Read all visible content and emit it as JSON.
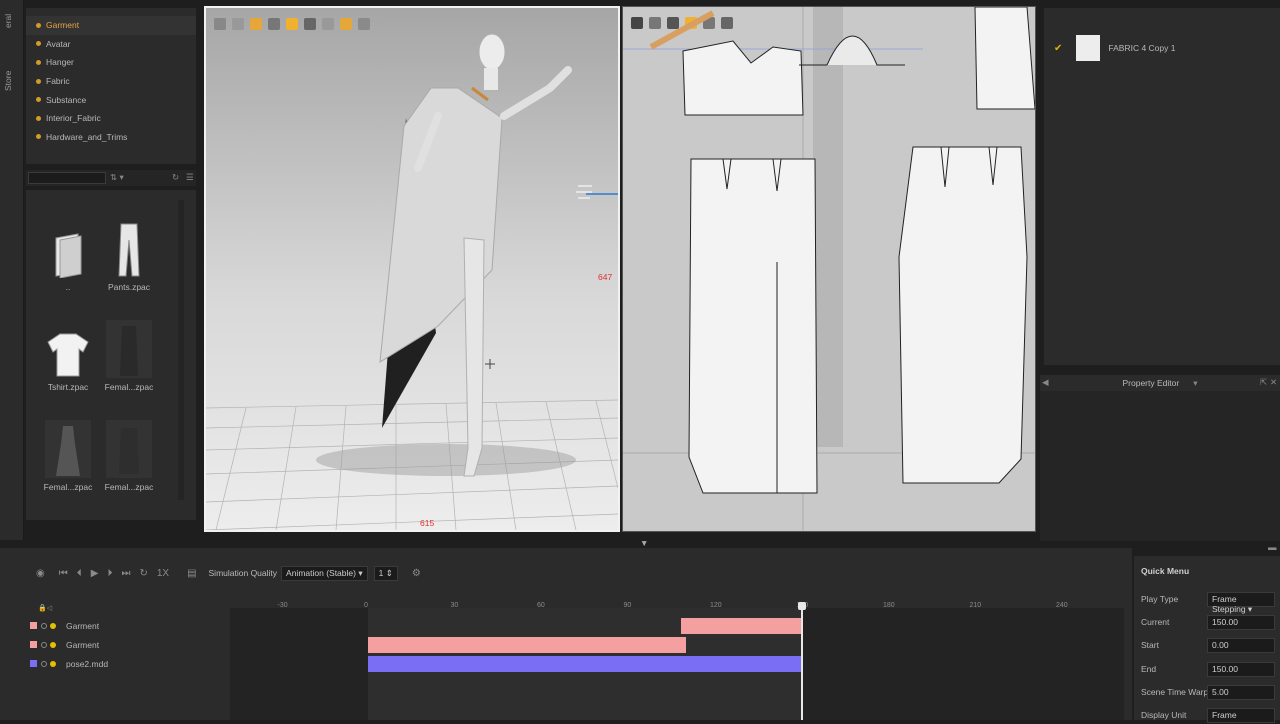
{
  "left_rail": {
    "tabs": [
      "eral",
      "Store"
    ]
  },
  "library": {
    "items": [
      {
        "label": "Garment",
        "active": true
      },
      {
        "label": "Avatar"
      },
      {
        "label": "Hanger"
      },
      {
        "label": "Fabric"
      },
      {
        "label": "Substance"
      },
      {
        "label": "Interior_Fabric"
      },
      {
        "label": "Hardware_and_Trims"
      }
    ]
  },
  "files": [
    {
      "label": "..",
      "icon": "folder-icon"
    },
    {
      "label": "Pants.zpac",
      "icon": "pants-icon"
    },
    {
      "label": "Tshirt.zpac",
      "icon": "tshirt-icon"
    },
    {
      "label": "Femal...zpac",
      "icon": "female-garment-icon"
    },
    {
      "label": "Femal...zpac",
      "icon": "dress-icon"
    },
    {
      "label": "Femal...zpac",
      "icon": "female-garment-icon"
    }
  ],
  "viewport3d": {
    "label_right": "647",
    "label_bottom": "615"
  },
  "fabric_list": {
    "items": [
      {
        "label": "FABRIC 4 Copy 1",
        "checked": true
      }
    ]
  },
  "property_editor": {
    "title": "Property Editor"
  },
  "timeline": {
    "speed": "1X",
    "simulation_quality_label": "Simulation Quality",
    "simulation_quality_value": "Animation (Stable)",
    "step_value": "1",
    "ruler_ticks": [
      "-30",
      "0",
      "30",
      "60",
      "90",
      "120",
      "150",
      "180",
      "210",
      "240"
    ],
    "tracks": [
      {
        "name": "Garment",
        "color": "#f4a0a0"
      },
      {
        "name": "Garment",
        "color": "#f4a0a0"
      },
      {
        "name": "pose2.mdd",
        "color": "#7a6ef5"
      }
    ]
  },
  "quick_menu": {
    "title": "Quick Menu",
    "rows": [
      {
        "label": "Play Type",
        "value": "Frame Stepping"
      },
      {
        "label": "Current",
        "value": "150.00"
      },
      {
        "label": "Start",
        "value": "0.00"
      },
      {
        "label": "End",
        "value": "150.00"
      },
      {
        "label": "Scene Time Warp",
        "value": "5.00"
      },
      {
        "label": "Display Unit",
        "value": "Frame"
      }
    ]
  }
}
